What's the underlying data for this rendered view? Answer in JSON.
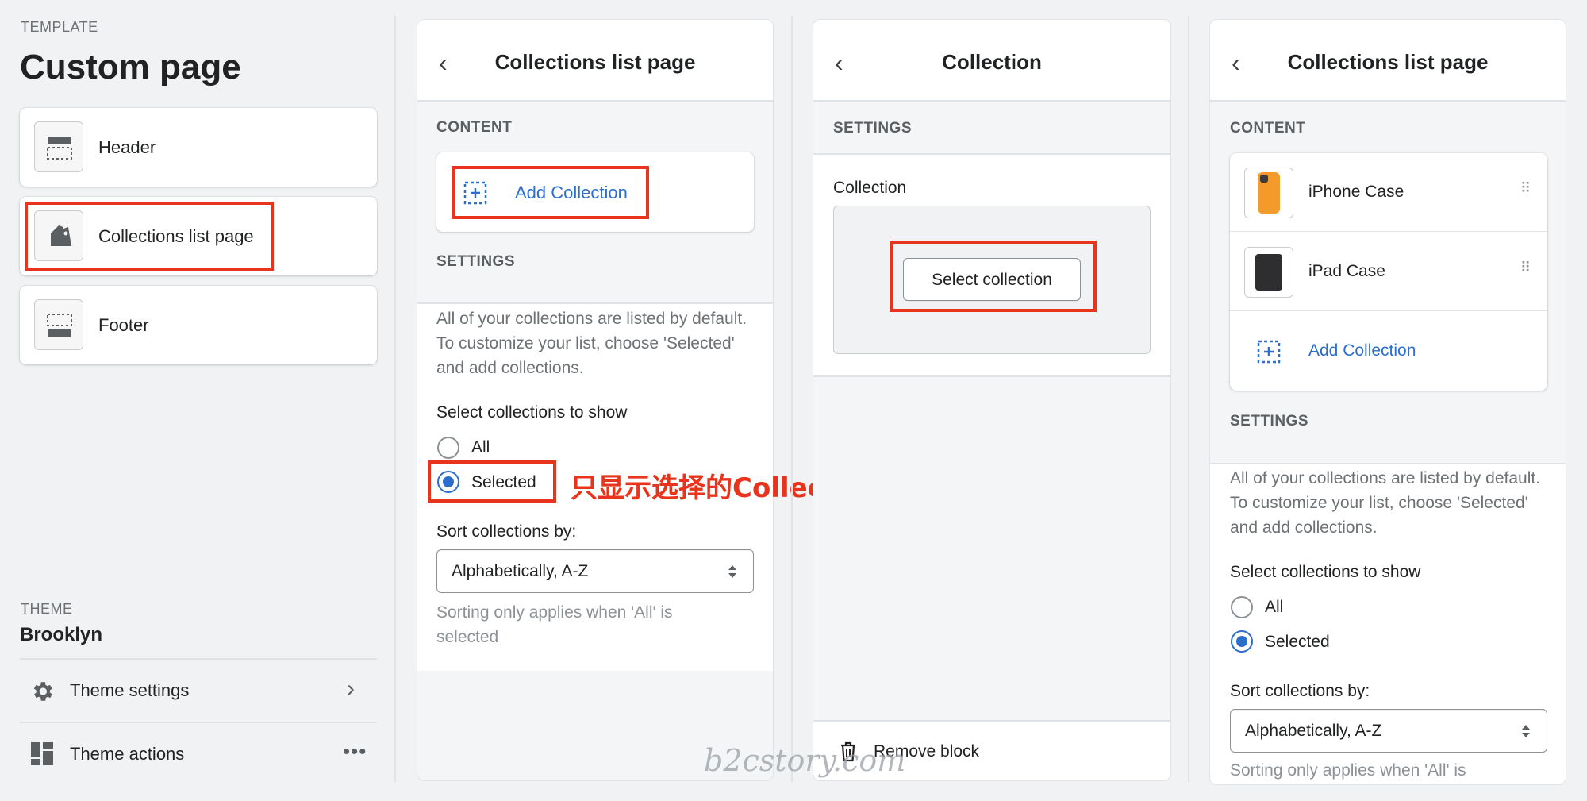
{
  "sidebar": {
    "template_label": "TEMPLATE",
    "page_title": "Custom page",
    "sections": [
      {
        "label": "Header",
        "icon": "header-layout-icon"
      },
      {
        "label": "Collections list page",
        "icon": "collections-tag-icon"
      },
      {
        "label": "Footer",
        "icon": "footer-layout-icon"
      }
    ],
    "theme_label": "THEME",
    "theme_name": "Brooklyn",
    "theme_settings": "Theme settings",
    "theme_actions": "Theme actions"
  },
  "panel1": {
    "title": "Collections list page",
    "content_label": "CONTENT",
    "add_collection": "Add Collection",
    "settings_label": "SETTINGS",
    "description": "All of your collections are listed by default. To customize your list, choose 'Selected' and add collections.",
    "select_label": "Select collections to show",
    "radio_all": "All",
    "radio_selected": "Selected",
    "selected_value": "Selected",
    "sort_label": "Sort collections by:",
    "sort_value": "Alphabetically, A-Z",
    "sort_help": "Sorting only applies when 'All' is selected"
  },
  "annotation": "只显示选择的Collection",
  "panel2": {
    "title": "Collection",
    "settings_label": "SETTINGS",
    "collection_label": "Collection",
    "select_button": "Select collection",
    "remove_block": "Remove block"
  },
  "panel3": {
    "title": "Collections list page",
    "content_label": "CONTENT",
    "items": [
      {
        "label": "iPhone Case",
        "thumb_color": "#f39a2c"
      },
      {
        "label": "iPad Case",
        "thumb_color": "#2e2e30"
      }
    ],
    "add_collection": "Add Collection",
    "settings_label": "SETTINGS",
    "description": "All of your collections are listed by default. To customize your list, choose 'Selected' and add collections.",
    "select_label": "Select collections to show",
    "radio_all": "All",
    "radio_selected": "Selected",
    "selected_value": "Selected",
    "sort_label": "Sort collections by:",
    "sort_value": "Alphabetically, A-Z",
    "sort_help": "Sorting only applies when 'All' is"
  },
  "watermark": "b2cstory.com",
  "colors": {
    "accent": "#2c6ecb",
    "highlight": "#e8341c",
    "annotation": "#e8341c"
  }
}
